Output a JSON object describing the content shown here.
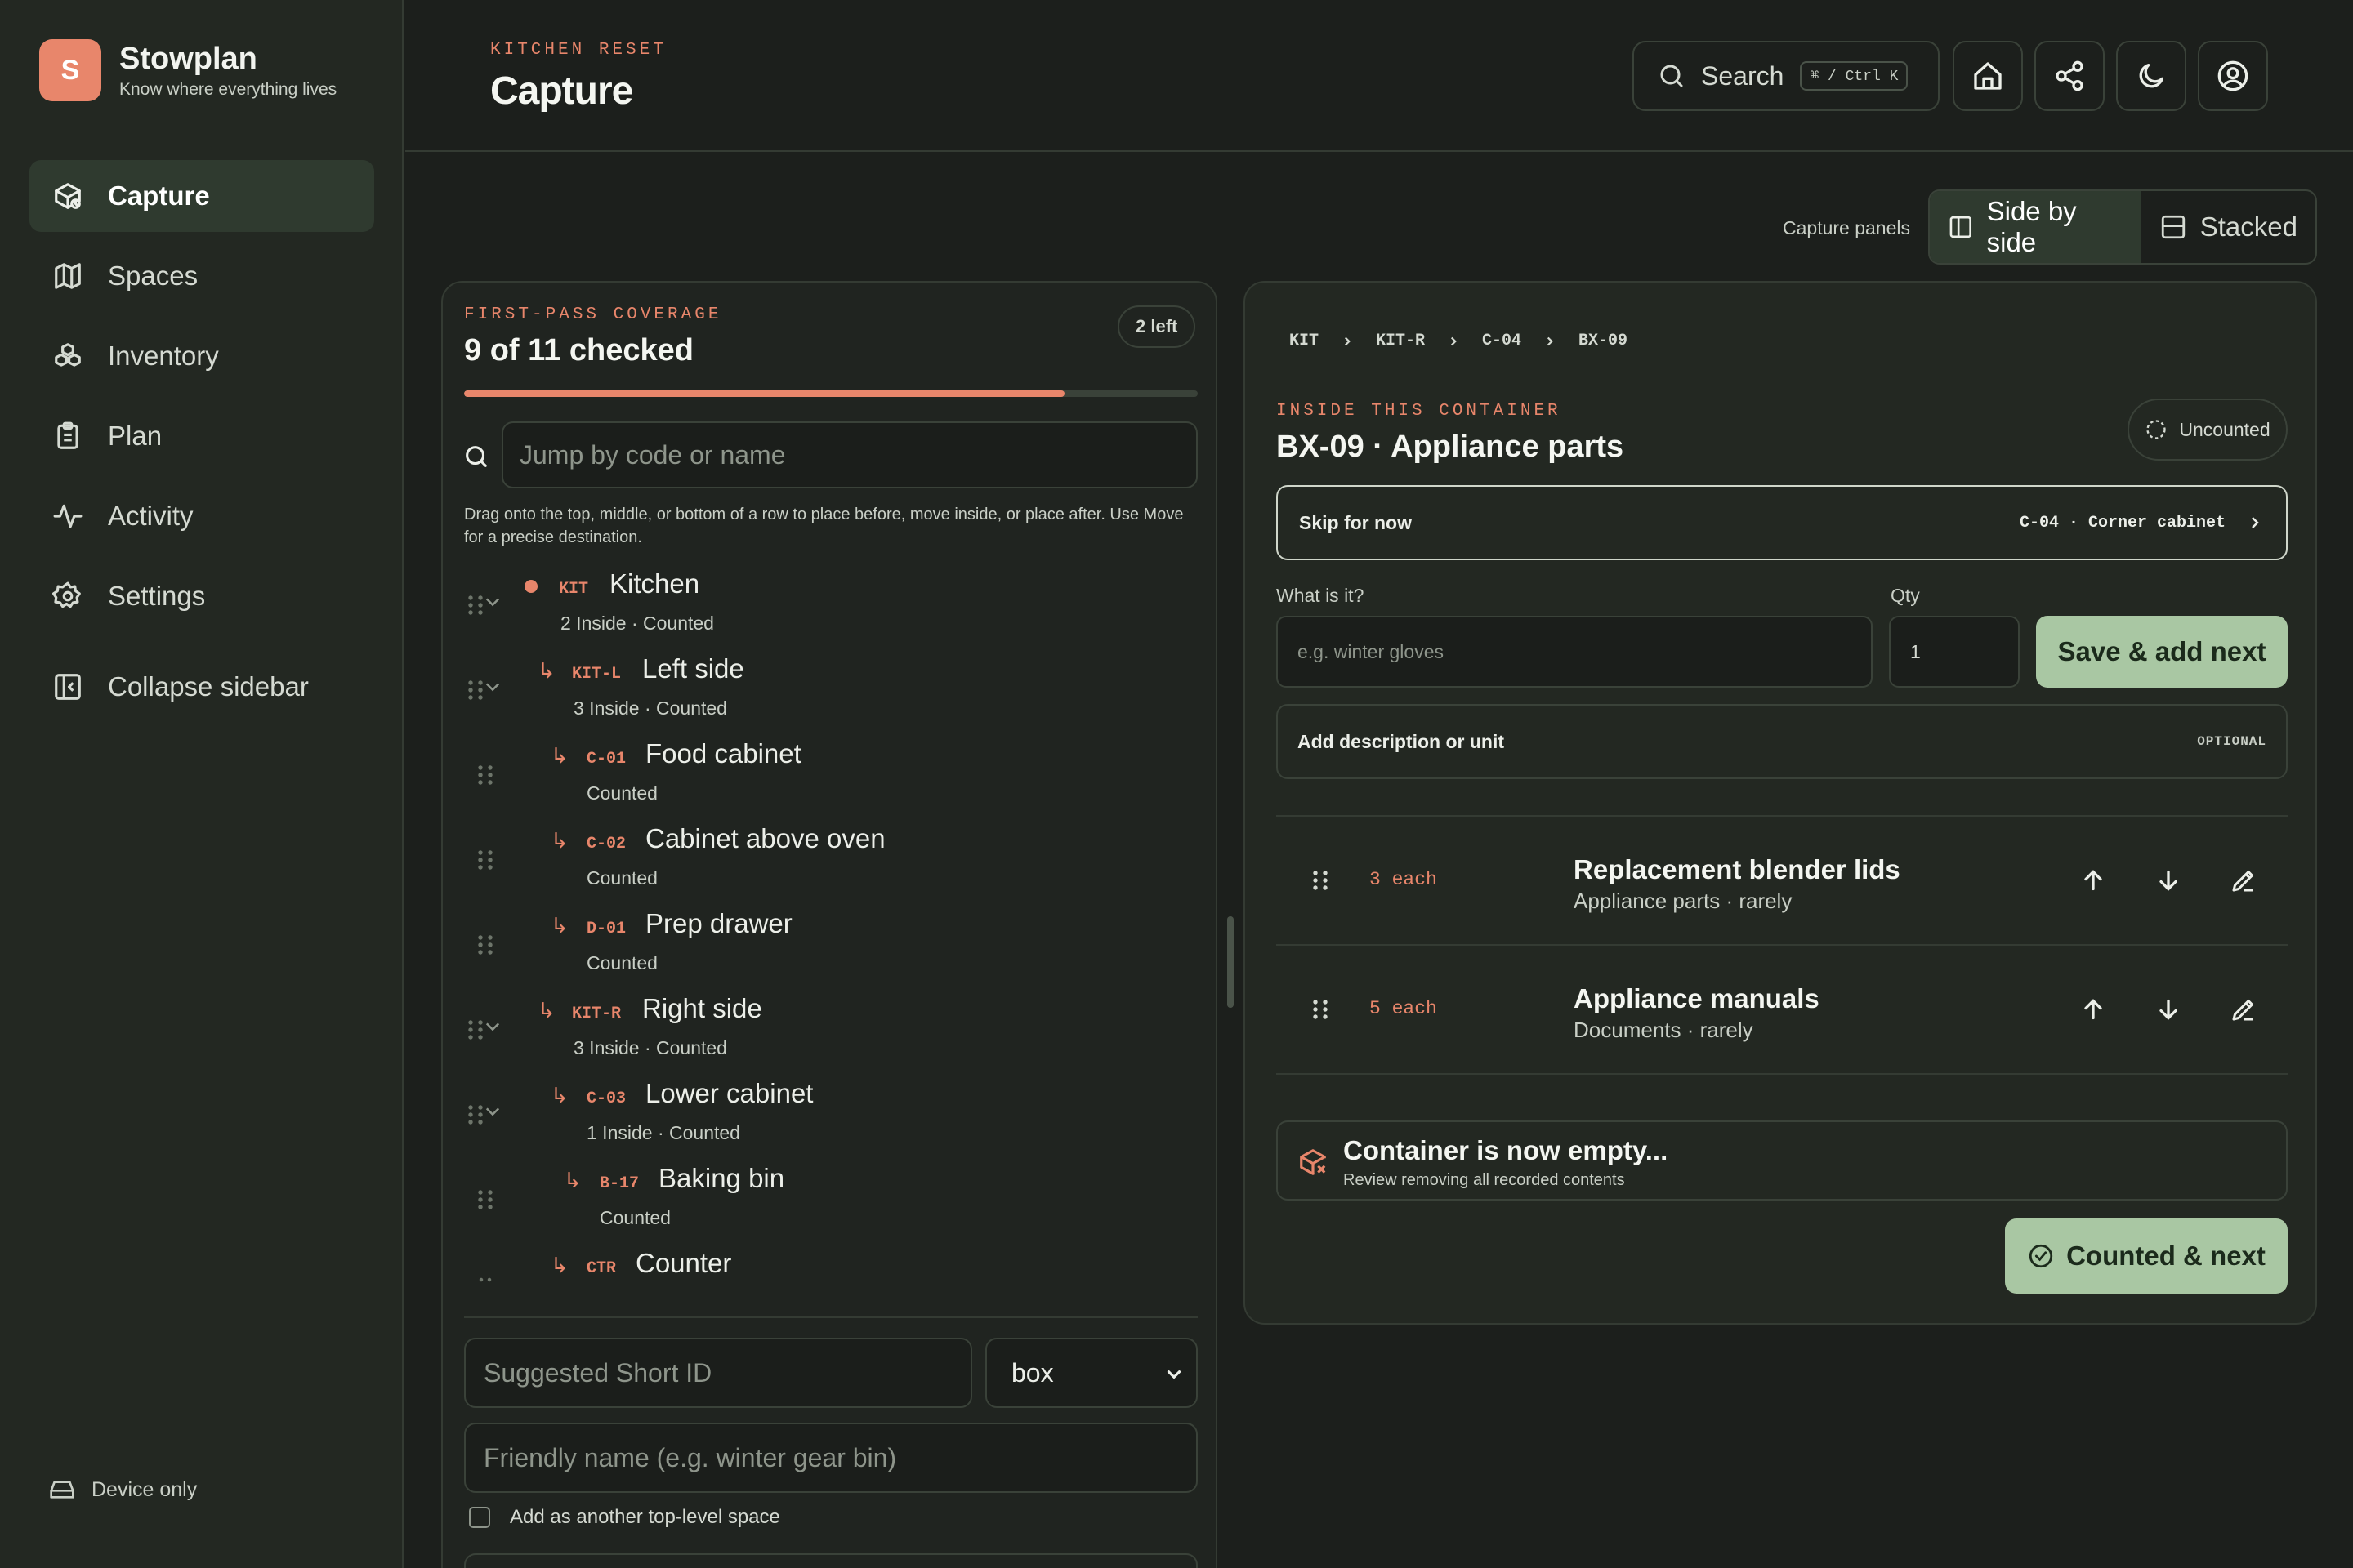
{
  "brand": {
    "logo_letter": "S",
    "name": "Stowplan",
    "tagline": "Know where everything lives"
  },
  "sidebar": {
    "items": [
      {
        "label": "Capture",
        "icon": "package-icon",
        "active": true
      },
      {
        "label": "Spaces",
        "icon": "map-icon"
      },
      {
        "label": "Inventory",
        "icon": "boxes-icon"
      },
      {
        "label": "Plan",
        "icon": "clipboard-icon"
      },
      {
        "label": "Activity",
        "icon": "activity-icon"
      },
      {
        "label": "Settings",
        "icon": "gear-icon"
      }
    ],
    "collapse_label": "Collapse sidebar",
    "storage_label": "Device only"
  },
  "header": {
    "eyebrow": "KITCHEN RESET",
    "title": "Capture",
    "search_label": "Search",
    "search_shortcut": "⌘ / Ctrl K"
  },
  "capture_panels": {
    "label": "Capture panels",
    "options": [
      "Side by side",
      "Stacked"
    ],
    "selected": "Side by side"
  },
  "coverage": {
    "eyebrow": "FIRST-PASS COVERAGE",
    "title": "9 of 11 checked",
    "badge": "2 left",
    "checked": 9,
    "total": 11
  },
  "tree_search": {
    "placeholder": "Jump by code or name"
  },
  "help_text": "Drag onto the top, middle, or bottom of a row to place before, move inside, or place after. Use Move for a precise destination.",
  "tree": [
    {
      "code": "KIT",
      "name": "Kitchen",
      "meta": "2 Inside · Counted"
    },
    {
      "code": "KIT-L",
      "name": "Left side",
      "meta": "3 Inside · Counted"
    },
    {
      "code": "C-01",
      "name": "Food cabinet",
      "meta": "Counted"
    },
    {
      "code": "C-02",
      "name": "Cabinet above oven",
      "meta": "Counted"
    },
    {
      "code": "D-01",
      "name": "Prep drawer",
      "meta": "Counted"
    },
    {
      "code": "KIT-R",
      "name": "Right side",
      "meta": "3 Inside · Counted"
    },
    {
      "code": "C-03",
      "name": "Lower cabinet",
      "meta": "1 Inside · Counted"
    },
    {
      "code": "B-17",
      "name": "Baking bin",
      "meta": "Counted"
    },
    {
      "code": "CTR",
      "name": "Counter",
      "meta": ""
    }
  ],
  "new_space": {
    "short_id_placeholder": "Suggested Short ID",
    "type_value": "box",
    "friendly_placeholder": "Friendly name (e.g. winter gear bin)",
    "top_level_label": "Add as another top-level space"
  },
  "container": {
    "breadcrumbs": [
      "KIT",
      "KIT-R",
      "C-04",
      "BX-09"
    ],
    "eyebrow": "INSIDE THIS CONTAINER",
    "title": "BX-09 · Appliance parts",
    "status": "Uncounted",
    "skip_label": "Skip for now",
    "skip_destination": "C-04 · Corner cabinet",
    "what_label": "What is it?",
    "what_placeholder": "e.g. winter gloves",
    "qty_label": "Qty",
    "qty_value": "1",
    "save_label": "Save & add next",
    "desc_label": "Add description or unit",
    "optional_label": "OPTIONAL",
    "items": [
      {
        "qty": "3 each",
        "name": "Replacement blender lids",
        "sub": "Appliance parts · rarely"
      },
      {
        "qty": "5 each",
        "name": "Appliance manuals",
        "sub": "Documents · rarely"
      }
    ],
    "empty_title": "Container is now empty...",
    "empty_sub": "Review removing all recorded contents",
    "counted_label": "Counted & next"
  }
}
